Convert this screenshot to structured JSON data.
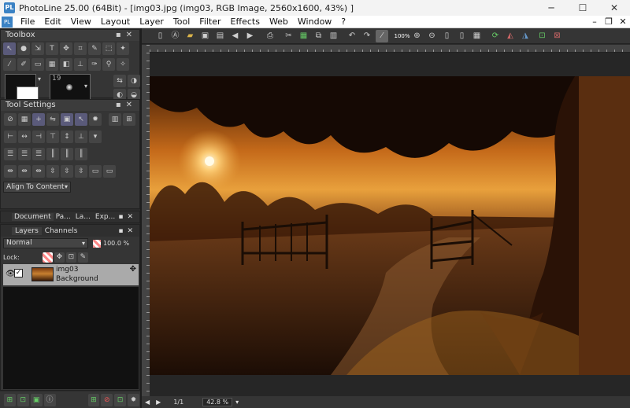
{
  "window": {
    "title": "PhotoLine 25.00 (64Bit) - [img03.jpg (img03, RGB Image, 2560x1600, 43%) ]",
    "app_icon": "PL",
    "minimize": "─",
    "maximize": "☐",
    "close": "✕"
  },
  "menubar": {
    "items": [
      "File",
      "Edit",
      "View",
      "Layout",
      "Layer",
      "Tool",
      "Filter",
      "Effects",
      "Web",
      "Window",
      "?"
    ],
    "right": [
      "–",
      "❐",
      "✕"
    ]
  },
  "toolbox": {
    "title": "Toolbox",
    "brush_size": "19"
  },
  "tool_settings": {
    "title": "Tool Settings",
    "align_select": "Align To Content"
  },
  "doc_tabs": {
    "tabs": [
      "Document",
      "Pa...",
      "La...",
      "Exp..."
    ]
  },
  "layers": {
    "tabs": [
      "Layers",
      "Channels"
    ],
    "blend_mode": "Normal",
    "opacity": "100.0 %",
    "lock_label": "Lock:",
    "layer_name": "img03",
    "layer_sub": "Background"
  },
  "toolbar": {
    "zoom_label": "100%"
  },
  "statusbar": {
    "page": "1/1",
    "zoom": "42.8 %"
  },
  "colors": {
    "panel_bg": "#353535",
    "accent": "#3b82c4",
    "selected_layer": "#aaaaaa"
  }
}
